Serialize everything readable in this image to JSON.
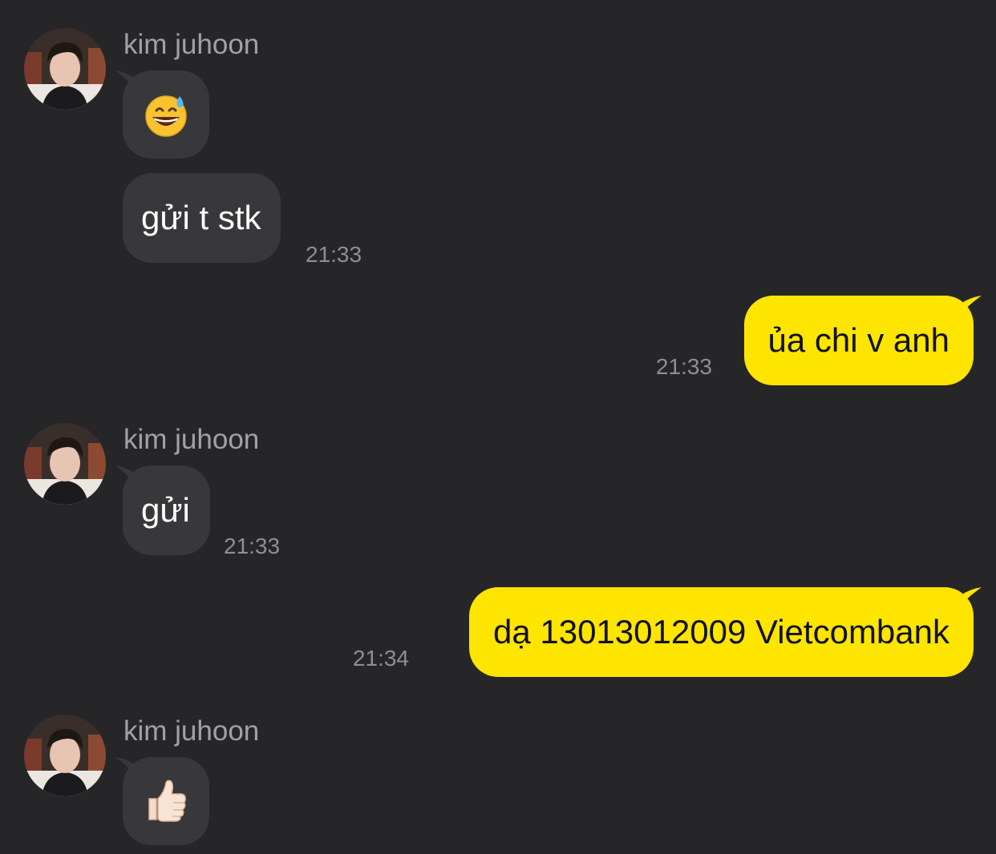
{
  "chat": {
    "messages": [
      {
        "sender": "kim juhoon",
        "bubbles": [
          {
            "type": "emoji",
            "emoji_name": "grinning-sweat-emoji"
          },
          {
            "type": "text",
            "text": "gửi t stk",
            "time": "21:33"
          }
        ]
      },
      {
        "sender": "me",
        "bubbles": [
          {
            "type": "text",
            "text": "ủa chi v anh",
            "time": "21:33"
          }
        ]
      },
      {
        "sender": "kim juhoon",
        "bubbles": [
          {
            "type": "text",
            "text": "gửi",
            "time": "21:33"
          }
        ]
      },
      {
        "sender": "me",
        "bubbles": [
          {
            "type": "text",
            "text": "dạ 13013012009 Vietcombank",
            "time": "21:34"
          }
        ]
      },
      {
        "sender": "kim juhoon",
        "bubbles": [
          {
            "type": "emoji",
            "emoji_name": "thumbs-up-emoji"
          }
        ]
      }
    ]
  },
  "colors": {
    "background": "#262628",
    "incoming_bubble": "#38383b",
    "outgoing_bubble": "#fee500",
    "timestamp": "#8e8e93",
    "sender_name": "#a2a2a6"
  }
}
